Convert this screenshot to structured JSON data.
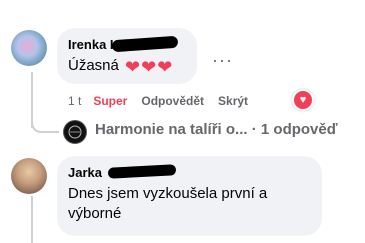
{
  "comment1": {
    "author": "Irenka K",
    "text": "Úžasná",
    "hearts": [
      "❤",
      "❤",
      "❤"
    ],
    "more_label": "···"
  },
  "actions": {
    "time": "1 t",
    "reaction": "Super",
    "reply": "Odpovědět",
    "hide": "Skrýt",
    "reaction_icon": "heart-icon",
    "reaction_color": "#f33e58"
  },
  "reply_summary": {
    "page_name": "Harmonie na talíři o...",
    "separator": "·",
    "count_text": "1 odpověď"
  },
  "comment2": {
    "author": "Jarka",
    "text": "Dnes jsem vyzkoušela první a výborné"
  },
  "colors": {
    "bubble": "#f0f2f5",
    "secondary_text": "#65676b",
    "thread_line": "#ced0d4"
  }
}
